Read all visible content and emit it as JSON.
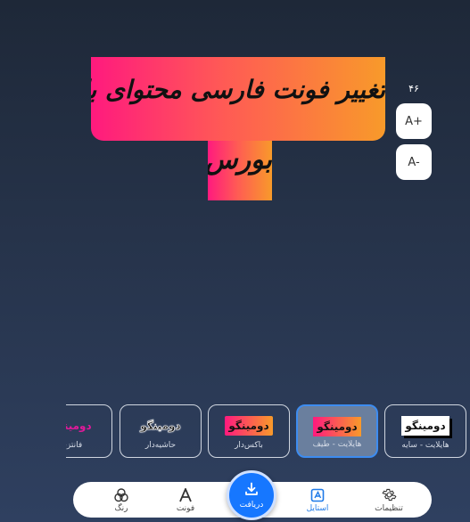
{
  "headline": {
    "line1": "تغییر فونت فارسی محتوای بازاریابی",
    "line2": "بورس"
  },
  "size_controls": {
    "value": "۴۶",
    "increase_label": "A+",
    "decrease_label": "A-"
  },
  "styles": {
    "items": [
      {
        "preview": "دومینگو",
        "label": "فانتزی",
        "variant": "fantasy"
      },
      {
        "preview": "دومینگو",
        "label": "حاشیه‌دار",
        "variant": "outline"
      },
      {
        "preview": "دومینگو",
        "label": "باکس‌دار",
        "variant": "box"
      },
      {
        "preview": "دومینگو",
        "label": "هایلایت - طیف",
        "variant": "gradient",
        "selected": true
      },
      {
        "preview": "دومینگو",
        "label": "هایلایت - سایه",
        "variant": "shadow"
      }
    ]
  },
  "bottom_nav": {
    "settings": {
      "label": "تنظیمات",
      "icon": "gear-icon"
    },
    "style": {
      "label": "استایل",
      "icon": "style-icon",
      "active": true
    },
    "download": {
      "label": "دریافت",
      "icon": "download-icon"
    },
    "font": {
      "label": "فونت",
      "icon": "font-icon"
    },
    "color": {
      "label": "رنگ",
      "icon": "color-circles-icon"
    }
  },
  "colors": {
    "accent": "#1677ff",
    "highlight_gradient_start": "#ff1a7e",
    "highlight_gradient_end": "#f89a2a"
  }
}
